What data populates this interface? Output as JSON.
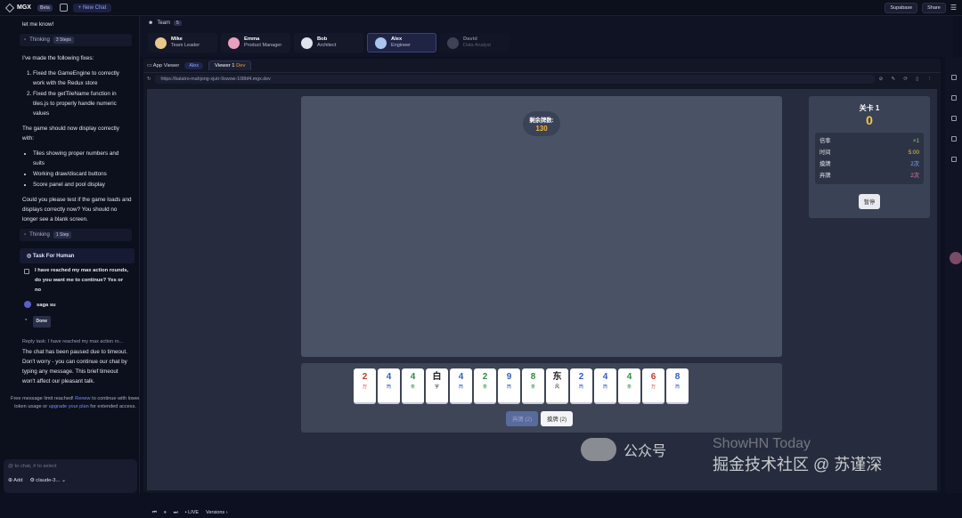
{
  "topbar": {
    "logo": "MGX",
    "beta": "Beta",
    "new_chat": "+ New Chat",
    "supabase": "Supabase",
    "share": "Share"
  },
  "chat": {
    "m1": "let me know!",
    "thinking1": "Thinking",
    "thinking1_badge": "3 Steps",
    "m2": "I've made the following fixes:",
    "fixes": [
      "Fixed the GameEngine to correctly work with the Redux store",
      "Fixed the getTileName function in tiles.js to properly handle numeric values"
    ],
    "m3": "The game should now display correctly with:",
    "bullets": [
      "Tiles showing proper numbers and suits",
      "Working draw/discard buttons",
      "Score panel and pool display"
    ],
    "m4": "Could you please test if the game loads and displays correctly now? You should no longer see a blank screen.",
    "thinking2": "Thinking",
    "thinking2_badge": "1 Step",
    "task_title": "Task For Human",
    "task_text": "I have reached my max action rounds, do you want me to continue? Yes or no",
    "user": "saga su",
    "done": "Done",
    "reply": "Reply task: I have reached my max action ro...",
    "m5": "The chat has been paused due to timeout. Don't worry - you can continue our chat by typing any message. This brief timeout won't affect our pleasant talk.",
    "free_a": "Free message limit reached! ",
    "free_link1": "Renew",
    "free_b": " to continue with lower token usage or ",
    "free_link2": "upgrade your plan",
    "free_c": " for extended access.",
    "input_placeholder": "@ to chat, # to select",
    "add": "Add",
    "model": "claude-3..."
  },
  "team": {
    "label": "Team",
    "count": "5",
    "members": [
      {
        "name": "Mike",
        "role": "Team Leader"
      },
      {
        "name": "Emma",
        "role": "Product Manager"
      },
      {
        "name": "Bob",
        "role": "Architect"
      },
      {
        "name": "Alex",
        "role": "Engineer"
      },
      {
        "name": "David",
        "role": "Data Analyst"
      }
    ]
  },
  "viewer": {
    "app_viewer": "App Viewer",
    "alex": "Alex",
    "tab": "Viewer 1",
    "dev": "Dev",
    "url": "https://balatro-mahjong-xjutr-9swow-108bf4.mgx.dev",
    "live": "LIVE",
    "versions": "Versions"
  },
  "game": {
    "remaining_label": "剩余牌数:",
    "remaining": "130",
    "level": "关卡 1",
    "level_score": "0",
    "stats": [
      {
        "k": "倍率",
        "v": "×1",
        "c": "#8fd16a"
      },
      {
        "k": "时间",
        "v": "5:00",
        "c": "#f4c842"
      },
      {
        "k": "摸牌",
        "v": "2次",
        "c": "#7ca8ff"
      },
      {
        "k": "弃牌",
        "v": "2次",
        "c": "#e57ab0"
      }
    ],
    "pause": "暂停",
    "tiles": [
      {
        "v": "2",
        "s": "万",
        "c": "#c0392b"
      },
      {
        "v": "4",
        "s": "筒",
        "c": "#2f5fbf"
      },
      {
        "v": "4",
        "s": "条",
        "c": "#2e8b3e"
      },
      {
        "v": "白",
        "s": "字",
        "c": "#222"
      },
      {
        "v": "4",
        "s": "筒",
        "c": "#2f5fbf"
      },
      {
        "v": "2",
        "s": "条",
        "c": "#2e8b3e"
      },
      {
        "v": "9",
        "s": "筒",
        "c": "#2f5fbf"
      },
      {
        "v": "8",
        "s": "条",
        "c": "#2e8b3e"
      },
      {
        "v": "东",
        "s": "风",
        "c": "#222"
      },
      {
        "v": "2",
        "s": "筒",
        "c": "#2f5fbf"
      },
      {
        "v": "4",
        "s": "筒",
        "c": "#2f5fbf"
      },
      {
        "v": "4",
        "s": "条",
        "c": "#2e8b3e"
      },
      {
        "v": "6",
        "s": "万",
        "c": "#c0392b"
      },
      {
        "v": "8",
        "s": "筒",
        "c": "#2f5fbf"
      }
    ],
    "discard": "弃牌 (2)",
    "draw": "摸牌 (2)"
  },
  "watermark": {
    "a": "公众号",
    "b": "ShowHN Today",
    "c": "掘金技术社区 @ 苏谨深"
  }
}
